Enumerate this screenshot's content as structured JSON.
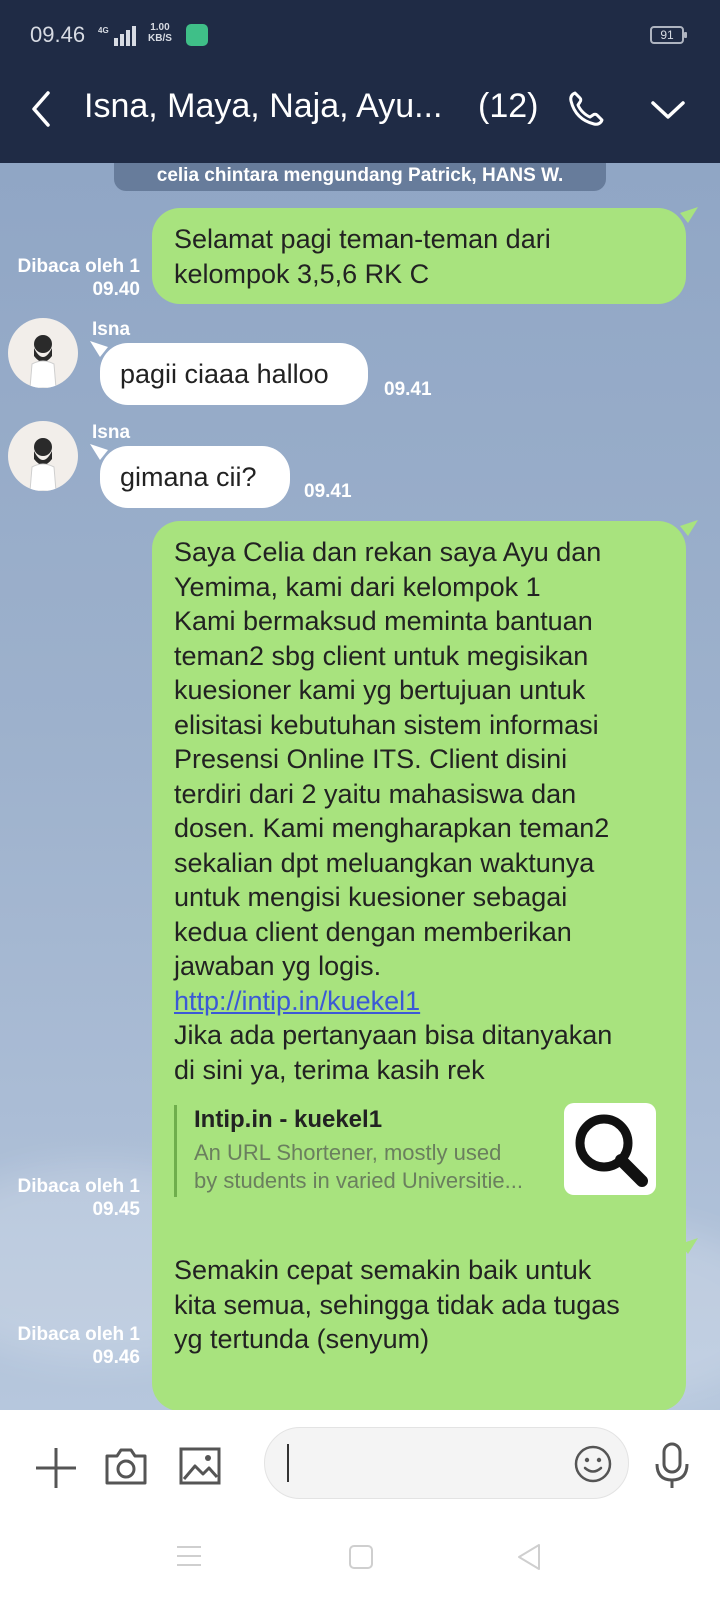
{
  "status_bar": {
    "time": "09.46",
    "network": "4G",
    "speed_value": "1.00",
    "speed_unit": "KB/S",
    "battery": "91"
  },
  "header": {
    "title": "Isna, Maya, Naja, Ayu...",
    "member_count": "(12)",
    "icons": [
      "back-icon",
      "phone-icon",
      "chevron-down-icon"
    ]
  },
  "system_message": "celia chintara mengundang Patrick, HANS W.",
  "messages": [
    {
      "direction": "out",
      "lines": [
        "Selamat pagi teman-teman dari",
        "kelompok 3,5,6 RK C"
      ],
      "read_label": "Dibaca oleh 1",
      "time": "09.40"
    },
    {
      "direction": "in",
      "sender": "Isna",
      "text": "pagii ciaaa halloo",
      "time": "09.41"
    },
    {
      "direction": "in",
      "sender": "Isna",
      "text": "gimana cii?",
      "time": "09.41"
    },
    {
      "direction": "out",
      "lines": [
        "Saya Celia dan rekan saya Ayu dan",
        "Yemima, kami dari kelompok 1",
        "Kami bermaksud meminta bantuan",
        "teman2 sbg client untuk  megisikan",
        "kuesioner kami yg bertujuan untuk",
        "elisitasi kebutuhan sistem informasi",
        "Presensi Online ITS. Client disini",
        "terdiri dari 2 yaitu mahasiswa dan",
        "dosen. Kami mengharapkan teman2",
        "sekalian dpt meluangkan waktunya",
        "untuk mengisi kuesioner sebagai",
        "kedua client dengan memberikan",
        "jawaban yg logis."
      ],
      "link": "http://intip.in/kuekel1",
      "after_lines": [
        "Jika ada pertanyaan bisa ditanyakan",
        "di sini ya, terima kasih rek"
      ],
      "preview": {
        "title": "Intip.in - kuekel1",
        "desc_1": "An URL Shortener, mostly used",
        "desc_2": "by students in varied Universitie..."
      },
      "read_label": "Dibaca oleh 1",
      "time": "09.45"
    },
    {
      "direction": "out",
      "lines": [
        "Semakin cepat semakin baik untuk",
        "kita semua, sehingga tidak ada tugas",
        "yg tertunda (senyum)"
      ],
      "read_label": "Dibaca oleh 1",
      "time": "09.46"
    }
  ],
  "input_bar": {
    "icons": [
      "plus-icon",
      "camera-icon",
      "image-icon",
      "emoji-icon",
      "microphone-icon"
    ],
    "text_value": ""
  },
  "nav_bar": {
    "icons": [
      "menu-icon",
      "home-icon",
      "back-triangle-icon"
    ]
  },
  "colors": {
    "header_bg": "#1f2b45",
    "outgoing_bubble": "#a8e37e",
    "incoming_bubble": "#ffffff",
    "link": "#3b59d6"
  }
}
